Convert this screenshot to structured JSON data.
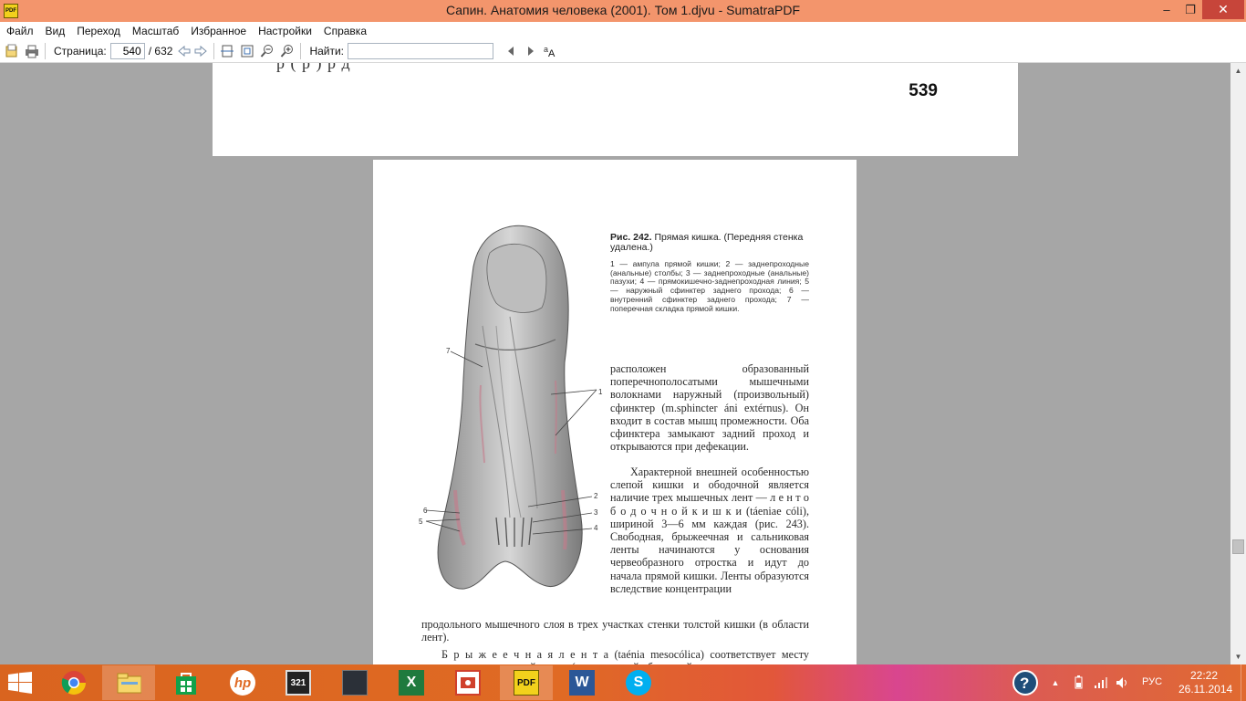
{
  "window": {
    "title": "Сапин. Анатомия человека (2001). Том 1.djvu - SumatraPDF",
    "app_icon_label": "PDF",
    "buttons": {
      "minimize": "–",
      "maximize": "❐",
      "close": "✕"
    }
  },
  "menu": {
    "items": [
      "Файл",
      "Вид",
      "Переход",
      "Масштаб",
      "Избранное",
      "Настройки",
      "Справка"
    ]
  },
  "toolbar": {
    "page_label": "Страница:",
    "page_value": "540",
    "page_total": "/ 632",
    "find_label": "Найти:",
    "find_value": ""
  },
  "document": {
    "prev_page_number": "539",
    "prev_page_cut_text": "р                ( р                                       )              р                           д",
    "figure_labels": [
      "7",
      "1",
      "2",
      "3",
      "4",
      "6",
      "5"
    ],
    "caption_title": "Рис. 242.",
    "caption_text": "Прямая кишка. (Передняя стенка удалена.)",
    "legend": "1 — ампула прямой кишки; 2 — заднепроходные (анальные) столбы; 3 — заднепроходные (анальные) пазухи; 4 — прямокишечно-заднепроходная линия; 5 — наружный сфинктер заднего прохода; 6 — внутренний сфинктер заднего прохода; 7 — поперечная складка прямой кишки.",
    "para_a": "расположен образованный поперечнополосатыми мышечными волокнами наружный (произвольный) сфинктер (m.sphincter áni extérnus). Он входит в состав мышц промежности. Оба сфинктера замыкают задний проход и открываются при дефекации.",
    "para_b": "Характерной внешней особенностью слепой кишки и ободочной является наличие трех мышечных лент — л е н т  о б о д о ч н о й  к и ш к и (táeniae cóli), шириной 3—6 мм каждая (рис. 243). Свободная, брыжеечная и сальниковая ленты начинаются у основания червеобразного отростка и идут до начала прямой кишки. Ленты образуются вследствие концентрации",
    "para_c": "продольного мышечного слоя в трех участках стенки толстой кишки (в области лент).",
    "para_d": "Б р ы ж е е ч н а я  л е н т а (taénia mesocólica) соответствует месту прикрепления к толстой кишке (к поперечной ободочной"
  },
  "scrollbar": {
    "up": "▲",
    "down": "▼",
    "position": 0.83
  },
  "taskbar": {
    "apps": [
      {
        "name": "chrome",
        "label": ""
      },
      {
        "name": "file-explorer",
        "label": ""
      },
      {
        "name": "store",
        "label": ""
      },
      {
        "name": "hp",
        "label": "hp"
      },
      {
        "name": "media-player-classic",
        "label": "321"
      },
      {
        "name": "app-dark",
        "label": ""
      },
      {
        "name": "excel",
        "label": "X"
      },
      {
        "name": "presentation",
        "label": ""
      },
      {
        "name": "sumatrapdf",
        "label": "PDF"
      },
      {
        "name": "word",
        "label": "W"
      },
      {
        "name": "skype",
        "label": "S"
      }
    ],
    "tray_lang": "РУС",
    "clock_time": "22:22",
    "clock_date": "26.11.2014",
    "colors": {
      "accent": "#e06a24",
      "titlebar": "#f3956c",
      "close": "#c7453a"
    }
  }
}
